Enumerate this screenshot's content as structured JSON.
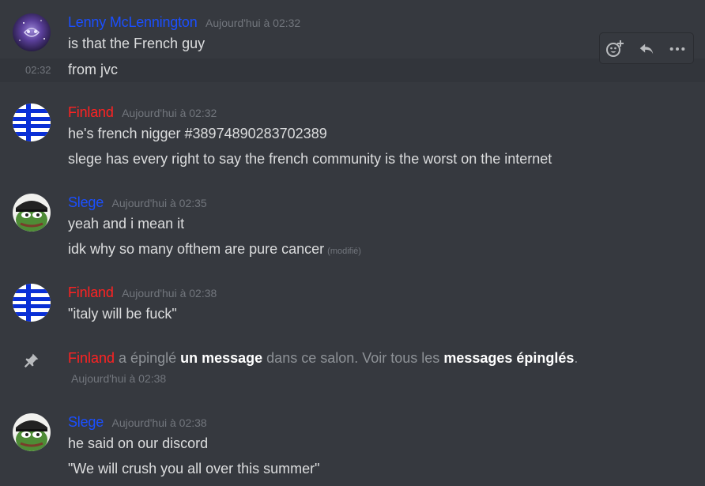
{
  "colors": {
    "background": "#36393f",
    "hover_row": "#32353b",
    "text": "#dcddde",
    "timestamp": "#72767d",
    "blue_user": "#1b4fff",
    "red_user": "#ff2222",
    "white_link": "#ffffff"
  },
  "messages": [
    {
      "username": "Lenny McLennington",
      "timestamp": "Aujourd'hui à 02:32",
      "avatar": "purple-galaxy-avatar",
      "lines": [
        "is that the French guy",
        "from jvc"
      ],
      "second_line_side_timestamp": "02:32"
    },
    {
      "username": "Finland",
      "timestamp": "Aujourd'hui à 02:32",
      "avatar": "finland-flag-avatar",
      "lines": [
        "he's french nigger #38974890283702389",
        "slege has every right to say the french community is the worst on the internet"
      ]
    },
    {
      "username": "Slege",
      "timestamp": "Aujourd'hui à 02:35",
      "avatar": "pepe-beret-avatar",
      "lines": [
        "yeah and i mean it",
        "idk why so many ofthem are pure cancer"
      ],
      "edited": "(modifié)"
    },
    {
      "username": "Finland",
      "timestamp": "Aujourd'hui à 02:38",
      "avatar": "finland-flag-avatar",
      "lines": [
        "\"italy will be fuck\""
      ]
    },
    {
      "username": "Slege",
      "timestamp": "Aujourd'hui à 02:38",
      "avatar": "pepe-beret-avatar",
      "lines": [
        "he said on our discord",
        "\"We will crush you all over this summer\""
      ]
    }
  ],
  "system": {
    "username": "Finland",
    "text1": " a épinglé ",
    "link1": "un message",
    "text2": " dans ce salon. Voir tous les ",
    "link2": "messages épinglés",
    "text3": ".",
    "timestamp": "Aujourd'hui à 02:38",
    "icon": "pin-icon"
  },
  "toolbar": {
    "icons": [
      "add-reaction-icon",
      "reply-icon",
      "more-options-icon"
    ]
  }
}
